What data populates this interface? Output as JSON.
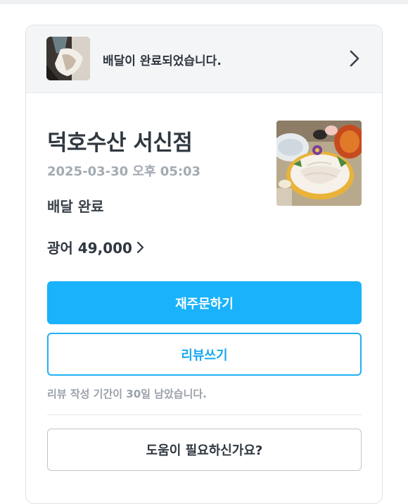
{
  "status_bar": {
    "message": "배달이 완료되었습니다."
  },
  "order": {
    "store_name": "덕호수산 서신점",
    "date": "2025-03-30 오후 05:03",
    "status": "배달 완료",
    "menu_summary": "광어 49,000"
  },
  "actions": {
    "reorder_label": "재주문하기",
    "review_label": "리뷰쓰기",
    "review_note": "리뷰 작성 기간이 30일 남았습니다.",
    "help_label": "도움이 필요하신가요?"
  },
  "colors": {
    "primary": "#1ab2fa",
    "text_dark": "#2f3740",
    "text_muted": "#9aa1a9"
  },
  "icons": {
    "status_chevron": "chevron-right-icon",
    "menu_chevron": "chevron-right-icon"
  }
}
